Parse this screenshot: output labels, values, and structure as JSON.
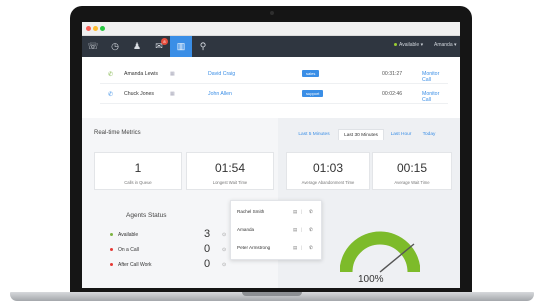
{
  "nav": {
    "icons": [
      "phone-icon",
      "clock-icon",
      "person-icon",
      "inbox-icon",
      "analytics-icon",
      "pin-icon"
    ],
    "inbox_badge": "8",
    "availability": "Available",
    "user": "Amanda"
  },
  "calls": [
    {
      "caller": "Amanda Lewis",
      "agent": "David Craig",
      "tag": "sales",
      "time": "00:31:27",
      "action": "Monitor Call",
      "icon": "phone-incoming-icon"
    },
    {
      "caller": "Chuck Jones",
      "agent": "John Allen",
      "tag": "support",
      "time": "00:02:46",
      "action": "Monitor Call",
      "icon": "phone-outgoing-icon"
    }
  ],
  "realtime": {
    "title": "Real-time Metrics",
    "calls_in_queue": {
      "value": "1",
      "label": "Calls in Queue"
    },
    "longest_wait": {
      "value": "01:54",
      "label": "Longest Wait Time"
    }
  },
  "range_tabs": [
    "Last 5 Minutes",
    "Last 30 Minutes",
    "Last Hour",
    "Today"
  ],
  "range_active": "Last 30 Minutes",
  "right_metrics": {
    "abandonment": {
      "value": "01:03",
      "label": "Average Abandonment Time"
    },
    "avg_wait": {
      "value": "00:15",
      "label": "Average Wait Time"
    }
  },
  "agents": {
    "title": "Agents Status",
    "items": [
      {
        "label": "Available",
        "count": "3",
        "color": "#7cb342"
      },
      {
        "label": "On a Call",
        "count": "0",
        "color": "#e53935"
      },
      {
        "label": "After Call Work",
        "count": "0",
        "color": "#e53935"
      }
    ]
  },
  "popup_agents": [
    "Rachel Smith",
    "Amanda",
    "Peter Armstrong"
  ],
  "gauge": {
    "percent": "100%",
    "fraction": 1.0,
    "color": "#7dbb2a"
  }
}
